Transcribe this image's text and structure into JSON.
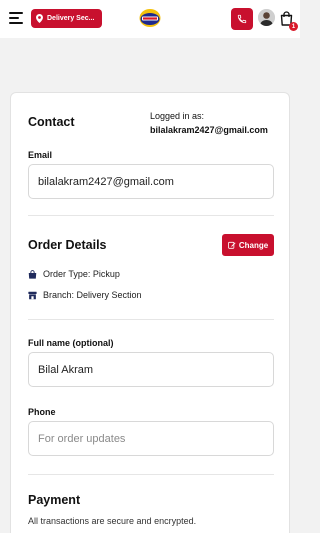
{
  "header": {
    "location_label": "Delivery Sec...",
    "cart_count": "1",
    "icons": [
      "menu-icon",
      "location-pin-icon",
      "logo",
      "phone-icon",
      "avatar",
      "shopping-bag-icon"
    ]
  },
  "contact": {
    "title": "Contact",
    "logged_in_label": "Logged in as:",
    "logged_in_email": "bilalakram2427@gmail.com",
    "email_label": "Email",
    "email_value": "bilalakram2427@gmail.com"
  },
  "order": {
    "title": "Order Details",
    "change_label": "Change",
    "order_type": "Order Type: Pickup",
    "branch": "Branch: Delivery Section"
  },
  "form": {
    "fullname_label": "Full name (optional)",
    "fullname_value": "Bilal Akram",
    "phone_label": "Phone",
    "phone_placeholder": "For order updates"
  },
  "payment": {
    "title": "Payment",
    "subtitle": "All transactions are secure and encrypted."
  },
  "colors": {
    "brand_red": "#c8102e",
    "page_bg": "#f2f2f2",
    "icon_navy": "#1f2a5c"
  }
}
